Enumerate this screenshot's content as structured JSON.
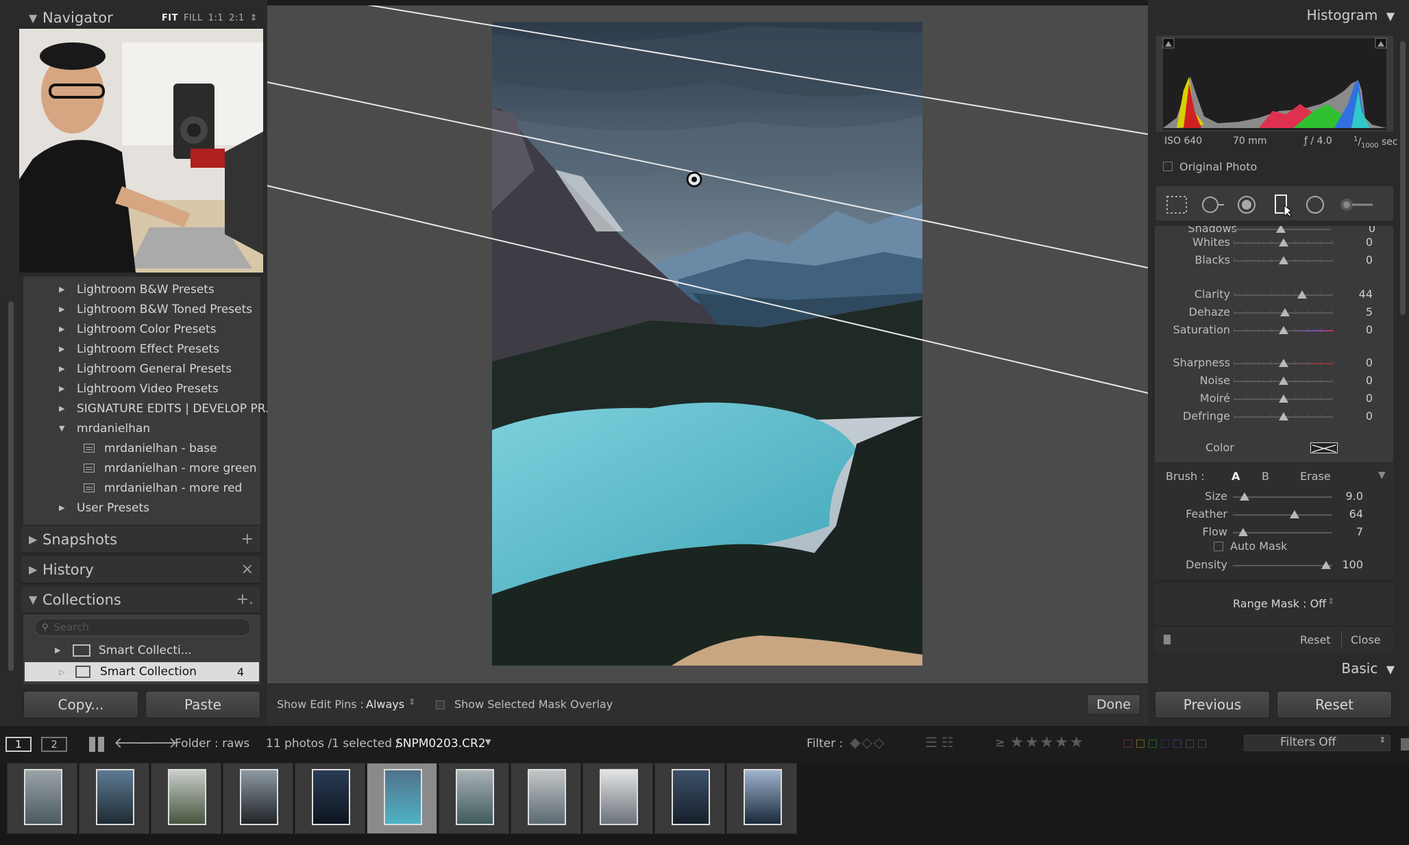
{
  "navigator": {
    "title": "Navigator",
    "modes": [
      "FIT",
      "FILL",
      "1:1",
      "2:1"
    ],
    "selected_mode": "FIT"
  },
  "presets": {
    "items": [
      {
        "label": "Lightroom B&W Presets"
      },
      {
        "label": "Lightroom B&W Toned Presets"
      },
      {
        "label": "Lightroom Color Presets"
      },
      {
        "label": "Lightroom Effect Presets"
      },
      {
        "label": "Lightroom General Presets"
      },
      {
        "label": "Lightroom Video Presets"
      },
      {
        "label": "SIGNATURE EDITS | DEVELOP PR..."
      },
      {
        "label": "mrdanielhan"
      },
      {
        "label": "mrdanielhan - base"
      },
      {
        "label": "mrdanielhan - more green"
      },
      {
        "label": "mrdanielhan - more red"
      },
      {
        "label": "User Presets"
      }
    ]
  },
  "panels": {
    "snapshots": "Snapshots",
    "history": "History",
    "collections": "Collections",
    "snapshots_action": "+",
    "history_action": "×",
    "collections_action": "+."
  },
  "collections": {
    "search_placeholder": "Search",
    "items": [
      {
        "label": "Smart Collecti...",
        "count": ""
      },
      {
        "label": "Smart Collection",
        "count": "4"
      }
    ]
  },
  "left_buttons": {
    "copy": "Copy...",
    "paste": "Paste"
  },
  "toolbar": {
    "show_edit_pins_label": "Show Edit Pins :",
    "show_edit_pins_value": "Always",
    "mask_overlay_label": "Show Selected Mask Overlay",
    "done": "Done"
  },
  "histogram": {
    "title": "Histogram",
    "iso": "ISO 640",
    "focal": "70 mm",
    "aperture": "ƒ / 4.0",
    "shutter_num": "1",
    "shutter_den": "1000",
    "shutter_unit": "sec",
    "original_photo": "Original Photo"
  },
  "adjust": {
    "partial_label": "Shadows",
    "sliders": [
      {
        "label": "Whites",
        "value": "0",
        "pos": 0.5
      },
      {
        "label": "Blacks",
        "value": "0",
        "pos": 0.5
      },
      {
        "label": "Clarity",
        "value": "44",
        "pos": 0.69
      },
      {
        "label": "Dehaze",
        "value": "5",
        "pos": 0.52
      },
      {
        "label": "Saturation",
        "value": "0",
        "pos": 0.5
      },
      {
        "label": "Sharpness",
        "value": "0",
        "pos": 0.5
      },
      {
        "label": "Noise",
        "value": "0",
        "pos": 0.5
      },
      {
        "label": "Moiré",
        "value": "0",
        "pos": 0.5
      },
      {
        "label": "Defringe",
        "value": "0",
        "pos": 0.5
      }
    ],
    "color_label": "Color"
  },
  "brush": {
    "label": "Brush :",
    "a": "A",
    "b": "B",
    "erase": "Erase",
    "sliders": [
      {
        "label": "Size",
        "value": "9.0",
        "pos": 0.12
      },
      {
        "label": "Feather",
        "value": "64",
        "pos": 0.62
      },
      {
        "label": "Flow",
        "value": "7",
        "pos": 0.1
      }
    ],
    "auto_mask": "Auto Mask",
    "density": {
      "label": "Density",
      "value": "100",
      "pos": 0.97
    },
    "range_mask": "Range Mask : Off",
    "reset": "Reset",
    "close": "Close"
  },
  "basic": "Basic",
  "right_buttons": {
    "previous": "Previous",
    "reset": "Reset"
  },
  "filmstrip_bar": {
    "screen1": "1",
    "screen2": "2",
    "folder": "Folder : raws",
    "count": "11 photos /1 selected /",
    "filename": "SNPM0203.CR2",
    "filter_label": "Filter :",
    "rating_op": "≥",
    "filters_off": "Filters Off"
  },
  "filmstrip": {
    "count": 11,
    "selected_index": 5
  },
  "colors": {
    "accent": "#c4c4c4",
    "lake": "#4fb3c4"
  }
}
